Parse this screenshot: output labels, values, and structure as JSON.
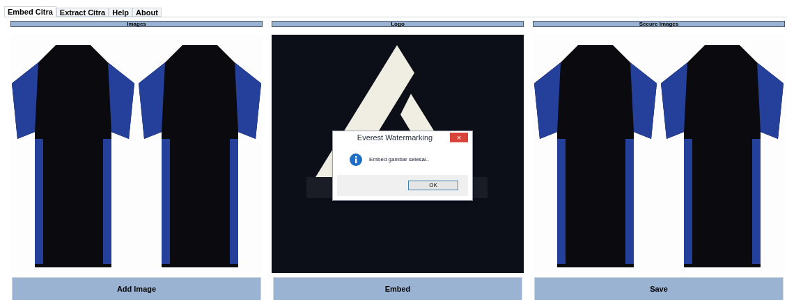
{
  "tabs": [
    {
      "label": "Embed Citra",
      "selected": true
    },
    {
      "label": "Extract Citra",
      "selected": false
    },
    {
      "label": "Help",
      "selected": false
    },
    {
      "label": "About",
      "selected": false
    }
  ],
  "panels": [
    {
      "header": "Images",
      "kind": "picture",
      "button": "Add Image"
    },
    {
      "header": "Logo",
      "kind": "picture",
      "button": "Embed"
    },
    {
      "header": "Secure Images",
      "kind": "picture",
      "button": "Save"
    }
  ],
  "dialog": {
    "title": "Everest Watermarking",
    "close": "×",
    "message": "Embed gambar selesai..",
    "button": "OK"
  }
}
